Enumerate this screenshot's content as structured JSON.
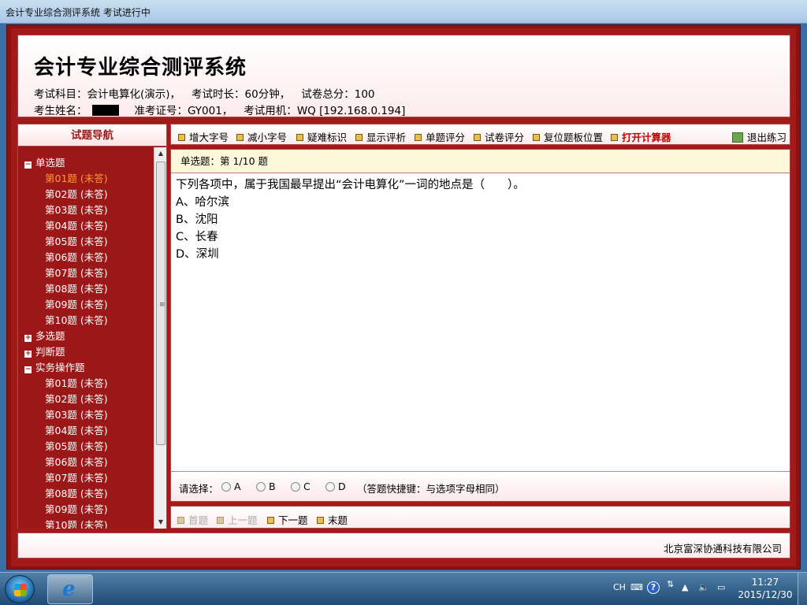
{
  "window": {
    "title": "会计专业综合测评系统 考试进行中"
  },
  "header": {
    "title": "会计专业综合测评系统",
    "subject_label": "考试科目：",
    "subject": "会计电算化(演示)，",
    "duration_label": "考试时长：",
    "duration": "60分钟，",
    "total_label": "试卷总分：",
    "total": "100",
    "name_label": "考生姓名：",
    "ticket_label": "准考证号：",
    "ticket": "GY001，",
    "machine_label": "考试用机：",
    "machine": "WQ [192.168.0.194]"
  },
  "nav": {
    "title": "试题导航",
    "rows": [
      {
        "kind": "group",
        "label": "单选题",
        "toggle": "−"
      },
      {
        "kind": "item",
        "label": "第01题 (未答)",
        "current": true
      },
      {
        "kind": "item",
        "label": "第02题 (未答)"
      },
      {
        "kind": "item",
        "label": "第03题 (未答)"
      },
      {
        "kind": "item",
        "label": "第04题 (未答)"
      },
      {
        "kind": "item",
        "label": "第05题 (未答)"
      },
      {
        "kind": "item",
        "label": "第06题 (未答)"
      },
      {
        "kind": "item",
        "label": "第07题 (未答)"
      },
      {
        "kind": "item",
        "label": "第08题 (未答)"
      },
      {
        "kind": "item",
        "label": "第09题 (未答)"
      },
      {
        "kind": "item",
        "label": "第10题 (未答)"
      },
      {
        "kind": "group",
        "label": "多选题",
        "toggle": "+"
      },
      {
        "kind": "group",
        "label": "判断题",
        "toggle": "+"
      },
      {
        "kind": "group",
        "label": "实务操作题",
        "toggle": "−"
      },
      {
        "kind": "item",
        "label": "第01题 (未答)"
      },
      {
        "kind": "item",
        "label": "第02题 (未答)"
      },
      {
        "kind": "item",
        "label": "第03题 (未答)"
      },
      {
        "kind": "item",
        "label": "第04题 (未答)"
      },
      {
        "kind": "item",
        "label": "第05题 (未答)"
      },
      {
        "kind": "item",
        "label": "第06题 (未答)"
      },
      {
        "kind": "item",
        "label": "第07题 (未答)"
      },
      {
        "kind": "item",
        "label": "第08题 (未答)"
      },
      {
        "kind": "item",
        "label": "第09题 (未答)"
      },
      {
        "kind": "item",
        "label": "第10题 (未答)"
      }
    ]
  },
  "toolbar": {
    "font_larger": "增大字号",
    "font_smaller": "减小字号",
    "mark_hard": "疑难标识",
    "show_analysis": "显示评析",
    "grade_question": "单题评分",
    "grade_paper": "试卷评分",
    "reset_panel": "复位题板位置",
    "calculator": "打开计算器",
    "exit": "退出练习"
  },
  "question": {
    "header": "单选题：第 1/10 题",
    "stem": "下列各项中，属于我国最早提出“会计电算化”一词的地点是（　　）。",
    "options": [
      "A、哈尔滨",
      "B、沈阳",
      "C、长春",
      "D、深圳"
    ]
  },
  "answer": {
    "prompt": "请选择：",
    "choices": [
      "A",
      "B",
      "C",
      "D"
    ],
    "hint": "（答题快捷键：与选项字母相同）"
  },
  "pager": {
    "first": "首题",
    "prev": "上一题",
    "next": "下一题",
    "last": "末题"
  },
  "footer": {
    "company": "北京富深协通科技有限公司"
  },
  "taskbar": {
    "ime": "CH",
    "time": "11:27",
    "date": "2015/12/30"
  }
}
